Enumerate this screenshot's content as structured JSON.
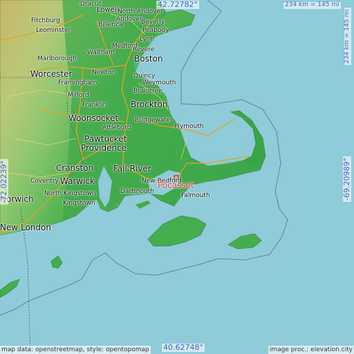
{
  "coords": {
    "top": "42.72782°",
    "bottom": "40.62748°",
    "left": "-72.02239°",
    "right": "-69.20989°"
  },
  "scale": {
    "horizontal": "234 km = 145 mi",
    "vertical": "234 km = 145 mi"
  },
  "highlight_city": "Pocasset",
  "cities": [
    {
      "name": "Dracut",
      "size": "small"
    },
    {
      "name": "Lowell",
      "size": "mid"
    },
    {
      "name": "North Andover",
      "size": "small"
    },
    {
      "name": "Fitchburg",
      "size": "small"
    },
    {
      "name": "Andover",
      "size": "small"
    },
    {
      "name": "Leominster",
      "size": "small"
    },
    {
      "name": "Billerica",
      "size": "small"
    },
    {
      "name": "Beverly",
      "size": "small"
    },
    {
      "name": "Peabody",
      "size": "small"
    },
    {
      "name": "Lynn",
      "size": "small"
    },
    {
      "name": "Marlborough",
      "size": "small"
    },
    {
      "name": "Waltham",
      "size": "small"
    },
    {
      "name": "Medford",
      "size": "small"
    },
    {
      "name": "Revere",
      "size": "small"
    },
    {
      "name": "Boston",
      "size": "big"
    },
    {
      "name": "Worcester",
      "size": "big"
    },
    {
      "name": "Newton",
      "size": "small"
    },
    {
      "name": "Quincy",
      "size": "small"
    },
    {
      "name": "Weymouth",
      "size": "small"
    },
    {
      "name": "Framingham",
      "size": "small"
    },
    {
      "name": "Braintree",
      "size": "small"
    },
    {
      "name": "Milford",
      "size": "small"
    },
    {
      "name": "Franklin",
      "size": "small"
    },
    {
      "name": "Brockton",
      "size": "big"
    },
    {
      "name": "Woonsocket",
      "size": "big"
    },
    {
      "name": "Bridgewater",
      "size": "small"
    },
    {
      "name": "Attleboro",
      "size": "small"
    },
    {
      "name": "Plymouth",
      "size": "small"
    },
    {
      "name": "Pawtucket",
      "size": "big"
    },
    {
      "name": "Providence",
      "size": "big"
    },
    {
      "name": "Cranston",
      "size": "big"
    },
    {
      "name": "Fall River",
      "size": "big"
    },
    {
      "name": "Coventry",
      "size": "small"
    },
    {
      "name": "Warwick",
      "size": "big"
    },
    {
      "name": "New Bedford",
      "size": "small"
    },
    {
      "name": "Dartmouth",
      "size": "small"
    },
    {
      "name": "North Kingstown",
      "size": "small"
    },
    {
      "name": "Falmouth",
      "size": "small"
    },
    {
      "name": "Norwich",
      "size": "big"
    },
    {
      "name": "Kingstown",
      "size": "small"
    },
    {
      "name": "New London",
      "size": "big"
    }
  ],
  "credits": {
    "left": "map data: openstreetmap, style: opentopomap",
    "right": "image proc.: elevation.city"
  }
}
